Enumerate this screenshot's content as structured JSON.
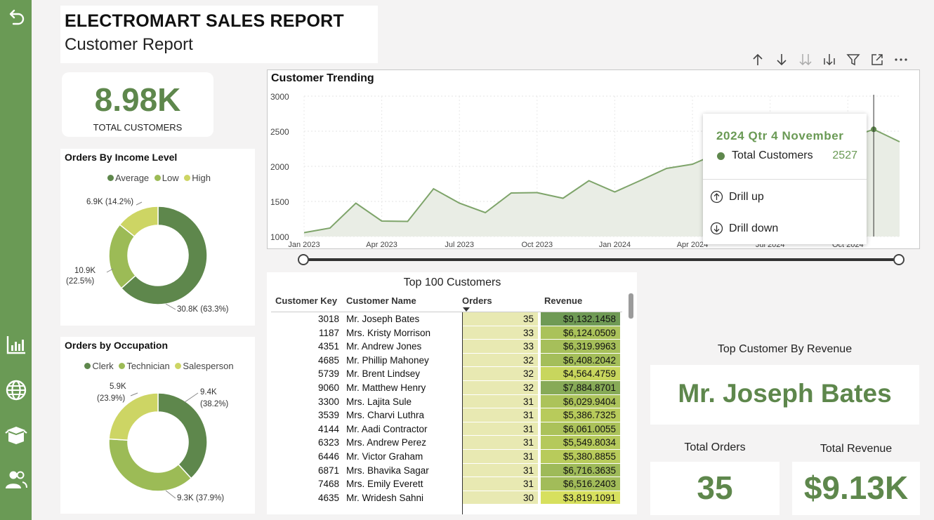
{
  "header": {
    "title": "ELECTROMART SALES REPORT",
    "subtitle": "Customer Report"
  },
  "kpi": {
    "value": "8.98K",
    "label": "TOTAL CUSTOMERS"
  },
  "income": {
    "title": "Orders By Income Level",
    "legend": [
      "Average",
      "Low",
      "High"
    ],
    "labels": [
      "30.8K (63.3%)",
      "10.9K",
      "(22.5%)",
      "6.9K (14.2%)"
    ]
  },
  "occupation": {
    "title": "Orders by Occupation",
    "legend": [
      "Clerk",
      "Technician",
      "Salesperson"
    ],
    "labels": [
      "9.4K",
      "(38.2%)",
      "9.3K (37.9%)",
      "5.9K",
      "(23.9%)"
    ]
  },
  "colors": {
    "dark": "#5e874c",
    "mid": "#9cbb56",
    "light": "#cdd564",
    "sidebar": "#6a9a55"
  },
  "chart_data": [
    {
      "type": "area",
      "title": "Customer Trending",
      "ylim": [
        1000,
        3000
      ],
      "y_ticks": [
        "3000",
        "2500",
        "2000",
        "1500",
        "1000"
      ],
      "x_ticks": [
        "Jan 2023",
        "Apr 2023",
        "Jul 2023",
        "Oct 2023",
        "Jan 2024",
        "Apr 2024",
        "Jul 2024",
        "Oct 2024"
      ],
      "x": [
        "Jan 2023",
        "Feb 2023",
        "Mar 2023",
        "Apr 2023",
        "May 2023",
        "Jun 2023",
        "Jul 2023",
        "Aug 2023",
        "Sep 2023",
        "Oct 2023",
        "Nov 2023",
        "Dec 2023",
        "Jan 2024",
        "Feb 2024",
        "Mar 2024",
        "Apr 2024",
        "May 2024",
        "Jun 2024",
        "Jul 2024",
        "Aug 2024",
        "Sep 2024",
        "Oct 2024",
        "Nov 2024",
        "Dec 2024"
      ],
      "series": [
        {
          "name": "Total Customers",
          "values": [
            1055,
            1120,
            1475,
            1220,
            1215,
            1680,
            1475,
            1340,
            1620,
            1625,
            1545,
            1795,
            1635,
            1800,
            1970,
            2030,
            2190,
            2070,
            2120,
            2320,
            2430,
            2400,
            2527,
            2350
          ]
        }
      ],
      "highlight_index": 22,
      "grid": true
    },
    {
      "type": "pie",
      "title": "Orders By Income Level",
      "categories": [
        "Average",
        "Low",
        "High"
      ],
      "values": [
        30.8,
        10.9,
        6.9
      ],
      "unit": "K"
    },
    {
      "type": "pie",
      "title": "Orders by Occupation",
      "categories": [
        "Clerk",
        "Technician",
        "Salesperson"
      ],
      "values": [
        9.4,
        9.3,
        5.9
      ],
      "unit": "K"
    }
  ],
  "tooltip": {
    "header": "2024 Qtr 4 November",
    "series": "Total Customers",
    "value": "2527",
    "drill_up": "Drill up",
    "drill_down": "Drill down"
  },
  "table": {
    "title": "Top 100 Customers",
    "columns": [
      "Customer Key",
      "Customer Name",
      "Orders",
      "Revenue"
    ],
    "rows": [
      [
        "3018",
        "Mr. Joseph Bates",
        "35",
        "$9,132.1458"
      ],
      [
        "1187",
        "Mrs. Kristy Morrison",
        "33",
        "$6,124.0509"
      ],
      [
        "4351",
        "Mr. Andrew Jones",
        "33",
        "$6,319.9963"
      ],
      [
        "4685",
        "Mr. Phillip Mahoney",
        "32",
        "$6,408.2042"
      ],
      [
        "5739",
        "Mr. Brent Lindsey",
        "32",
        "$4,564.4759"
      ],
      [
        "9060",
        "Mr. Matthew Henry",
        "32",
        "$7,884.8701"
      ],
      [
        "3300",
        "Mrs. Lajita Sule",
        "31",
        "$6,029.9404"
      ],
      [
        "3539",
        "Mrs. Charvi Luthra",
        "31",
        "$5,386.7325"
      ],
      [
        "4144",
        "Mr. Aadi Contractor",
        "31",
        "$6,061.0055"
      ],
      [
        "6323",
        "Mrs. Andrew Perez",
        "31",
        "$5,549.8034"
      ],
      [
        "6446",
        "Mr. Victor Graham",
        "31",
        "$5,380.8855"
      ],
      [
        "6871",
        "Mrs. Bhavika Sagar",
        "31",
        "$6,716.3635"
      ],
      [
        "7468",
        "Mrs. Emily Everett",
        "31",
        "$6,516.2403"
      ],
      [
        "4635",
        "Mr. Wridesh Sahni",
        "30",
        "$3,819.1091"
      ]
    ],
    "orders_values": [
      35,
      33,
      33,
      32,
      32,
      32,
      31,
      31,
      31,
      31,
      31,
      31,
      31,
      30
    ],
    "revenue_values": [
      9132.1458,
      6124.0509,
      6319.9963,
      6408.2042,
      4564.4759,
      7884.8701,
      6029.9404,
      5386.7325,
      6061.0055,
      5549.8034,
      5380.8855,
      6716.3635,
      6516.2403,
      3819.1091
    ]
  },
  "top_customer": {
    "label": "Top Customer By Revenue",
    "name": "Mr. Joseph Bates",
    "orders_label": "Total Orders",
    "orders_value": "35",
    "revenue_label": "Total Revenue",
    "revenue_value": "$9.13K"
  }
}
